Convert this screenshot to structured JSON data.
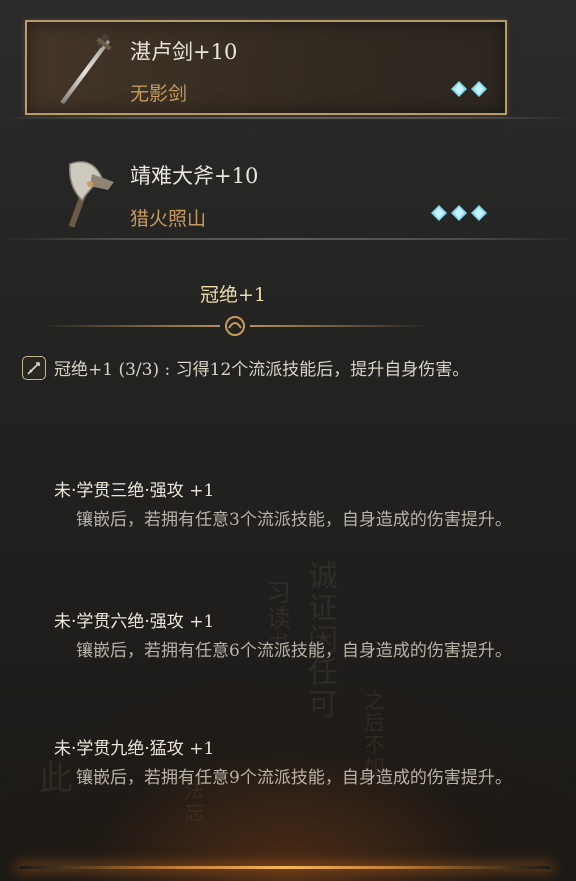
{
  "weapons": [
    {
      "name": "湛卢剑+10",
      "skill": "无影剑",
      "gems": 2,
      "selected": true,
      "icon": "sword-icon"
    },
    {
      "name": "靖难大斧+10",
      "skill": "猎火照山",
      "gems": 3,
      "selected": false,
      "icon": "axe-icon"
    }
  ],
  "set": {
    "title": "冠绝+1",
    "bonus_icon": "sword-stance-icon",
    "bonus_text": "冠绝+1 (3/3) : 习得12个流派技能后，提升自身伤害。"
  },
  "entries": [
    {
      "title": "未·学贯三绝·强攻 +1",
      "desc": "镶嵌后，若拥有任意3个流派技能，自身造成的伤害提升。"
    },
    {
      "title": "未·学贯六绝·强攻 +1",
      "desc": "镶嵌后，若拥有任意6个流派技能，自身造成的伤害提升。"
    },
    {
      "title": "未·学贯九绝·猛攻 +1",
      "desc": "镶嵌后，若拥有任意9个流派技能，自身造成的伤害提升。"
    }
  ],
  "colors": {
    "accent_gold": "#c79b5e",
    "frame_gold": "#b89a6c",
    "gem_cyan": "#7fd7f0"
  }
}
